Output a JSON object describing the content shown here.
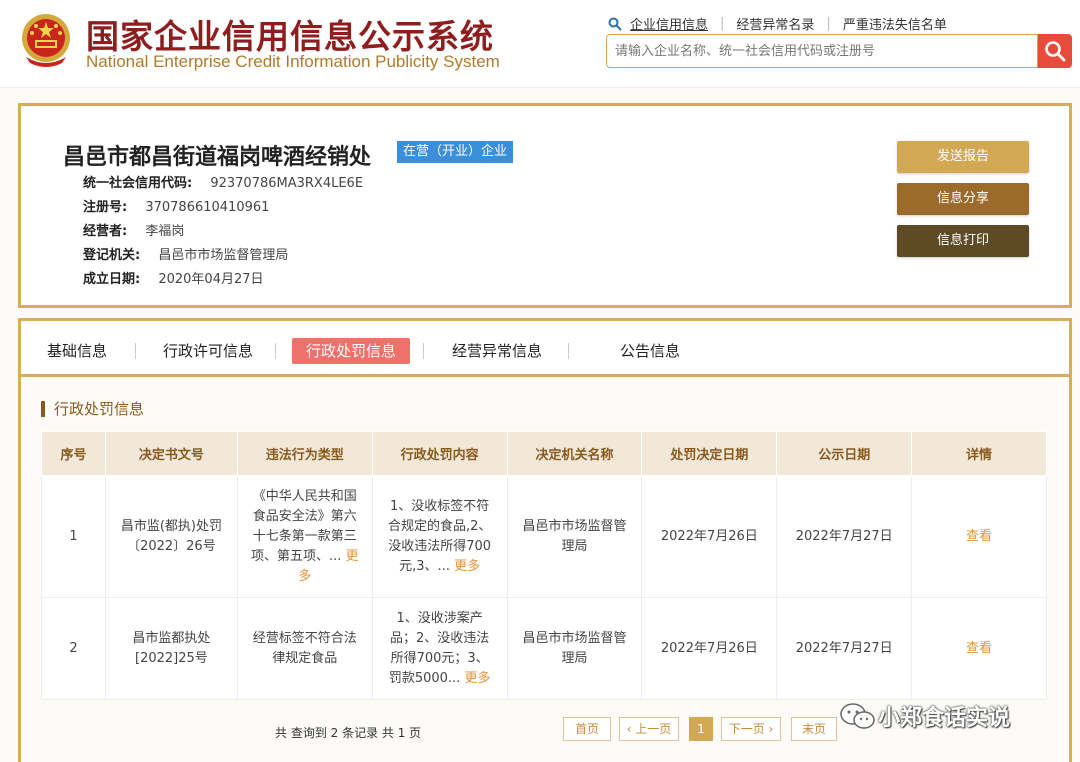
{
  "header": {
    "title_cn": "国家企业信用信息公示系统",
    "title_en": "National Enterprise Credit Information Publicity System",
    "nav": [
      "企业信用信息",
      "经营异常名录",
      "严重违法失信名单"
    ],
    "search_placeholder": "请输入企业名称、统一社会信用代码或注册号"
  },
  "company": {
    "name": "昌邑市都昌街道福岗啤酒经销处",
    "status": "在营（开业）企业",
    "fields": [
      {
        "label": "统一社会信用代码:",
        "value": "92370786MA3RX4LE6E"
      },
      {
        "label": "注册号:",
        "value": "370786610410961"
      },
      {
        "label": "经营者:",
        "value": "李福岗"
      },
      {
        "label": "登记机关:",
        "value": "昌邑市市场监督管理局"
      },
      {
        "label": "成立日期:",
        "value": "2020年04月27日"
      }
    ],
    "actions": [
      "发送报告",
      "信息分享",
      "信息打印"
    ]
  },
  "tabs": [
    "基础信息",
    "行政许可信息",
    "行政处罚信息",
    "经营异常信息",
    "公告信息"
  ],
  "section_title": "行政处罚信息",
  "table": {
    "headers": [
      "序号",
      "决定书文号",
      "违法行为类型",
      "行政处罚内容",
      "决定机关名称",
      "处罚决定日期",
      "公示日期",
      "详情"
    ],
    "rows": [
      {
        "no": "1",
        "doc": "昌市监(都执)处罚〔2022〕26号",
        "type": "《中华人民共和国食品安全法》第六十七条第一款第三项、第五项、...",
        "content": "1、没收标签不符合规定的食品,2、没收违法所得700元,3、...",
        "authority": "昌邑市市场监督管理局",
        "decision_date": "2022年7月26日",
        "publish_date": "2022年7月27日",
        "detail": "查看"
      },
      {
        "no": "2",
        "doc": "昌市监都执处[2022]25号",
        "type": "经营标签不符合法律规定食品",
        "content": "1、没收涉案产品；2、没收违法所得700元；3、罚款5000...",
        "authority": "昌邑市市场监督管理局",
        "decision_date": "2022年7月26日",
        "publish_date": "2022年7月27日",
        "detail": "查看"
      }
    ],
    "more": "更多"
  },
  "pagination": {
    "info": "共 查询到 2 条记录 共 1 页",
    "first": "首页",
    "prev": "‹ 上一页",
    "current": "1",
    "next": "下一页 ›",
    "last": "末页"
  },
  "watermark": "小郑食话实说",
  "colors": {
    "brand_red": "#8e1d1d",
    "gold": "#d6ad5e",
    "status_blue": "#3b8ed8",
    "active_tab": "#f0706a",
    "link_orange": "#e6923a"
  }
}
